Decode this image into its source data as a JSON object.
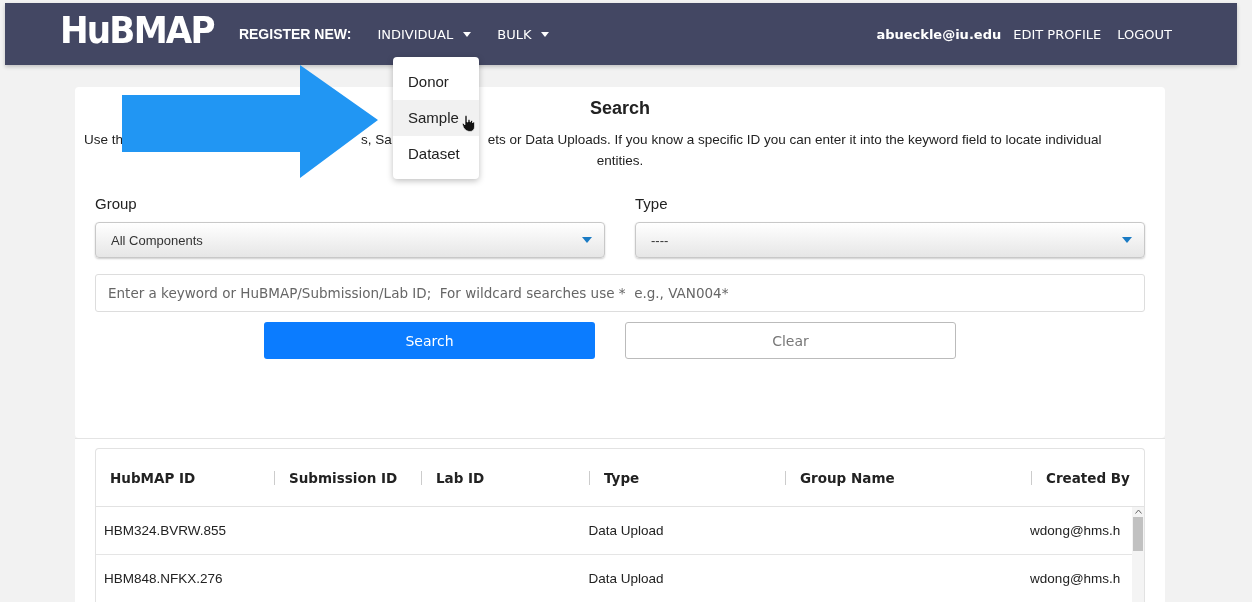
{
  "navbar": {
    "logo": "HuBMAP",
    "register_label": "REGISTER NEW:",
    "menus": [
      {
        "label": "INDIVIDUAL"
      },
      {
        "label": "BULK"
      }
    ],
    "user": "abueckle@iu.edu",
    "links": [
      "EDIT PROFILE",
      "LOGOUT"
    ]
  },
  "dropdown": {
    "items": [
      {
        "label": "Donor",
        "selected": false
      },
      {
        "label": "Sample",
        "selected": true
      },
      {
        "label": "Dataset",
        "selected": false
      }
    ]
  },
  "search_panel": {
    "title": "Search",
    "description_fragments": [
      "Use th",
      "s, Sa",
      "ets or Data Uploads. If you know a specific ID you can enter it into the keyword field to locate individual"
    ],
    "description_end": "entities.",
    "group": {
      "label": "Group",
      "value": "All Components"
    },
    "type": {
      "label": "Type",
      "value": "----"
    },
    "keyword": {
      "placeholder": "Enter a keyword or HuBMAP/Submission/Lab ID;  For wildcard searches use *  e.g., VAN004*"
    },
    "buttons": [
      {
        "label": "Search",
        "kind": "primary"
      },
      {
        "label": "Clear",
        "kind": "secondary"
      }
    ]
  },
  "table": {
    "columns": [
      "HubMAP ID",
      "Submission ID",
      "Lab ID",
      "Type",
      "Group Name",
      "Created By"
    ],
    "rows": [
      {
        "cells": [
          "HBM324.BVRW.855",
          "",
          "",
          "Data Upload",
          "",
          "wdong@hms.h"
        ]
      },
      {
        "cells": [
          "HBM848.NFKX.276",
          "",
          "",
          "Data Upload",
          "",
          "wdong@hms.h"
        ]
      }
    ]
  }
}
